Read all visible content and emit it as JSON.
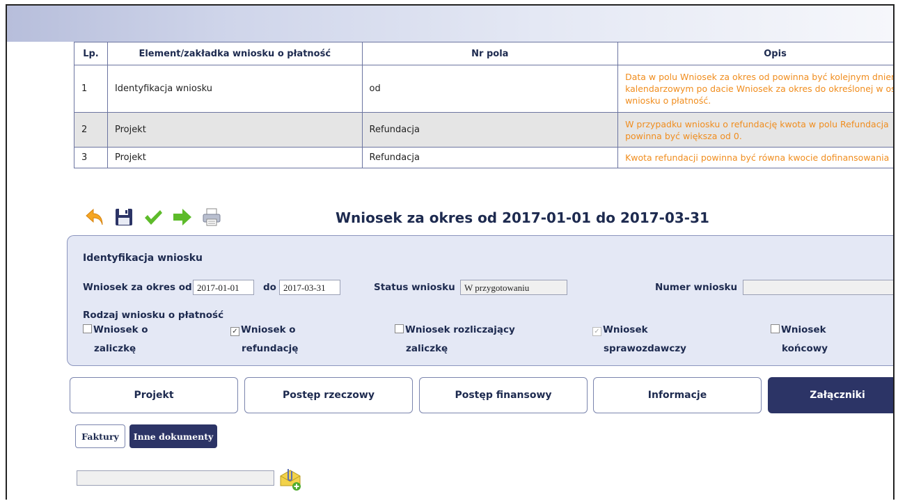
{
  "table": {
    "headers": [
      "Lp.",
      "Element/zakładka wniosku o płatność",
      "Nr pola",
      "Opis"
    ],
    "rows": [
      {
        "lp": "1",
        "element": "Identyfikacja wniosku",
        "pole": "od",
        "opis": "Data w polu Wniosek za okres od powinna być kolejnym dniem kalendarzowym po dacie Wniosek za okres do określonej w ostatnim wniosku o płatność."
      },
      {
        "lp": "2",
        "element": "Projekt",
        "pole": "Refundacja",
        "opis": "W przypadku wniosku o refundację kwota w polu Refundacja powinna być większa od 0."
      },
      {
        "lp": "3",
        "element": "Projekt",
        "pole": "Refundacja",
        "opis": "Kwota refundacji powinna być równa kwocie dofinansowania"
      }
    ]
  },
  "toolbar": {
    "icons": [
      "back-arrow-icon",
      "save-icon",
      "check-icon",
      "forward-arrow-icon",
      "print-icon"
    ]
  },
  "title": "Wniosek za okres od 2017-01-01 do 2017-03-31",
  "form": {
    "section": "Identyfikacja wniosku",
    "okres_od_label": "Wniosek za okres od",
    "okres_od": "2017-01-01",
    "do_label": "do",
    "okres_do": "2017-03-31",
    "status_label": "Status wniosku",
    "status": "W przygotowaniu",
    "numer_label": "Numer wniosku",
    "numer": "",
    "rodzaj_label": "Rodzaj wniosku o płatność",
    "checkboxes": [
      {
        "line1": "Wniosek o",
        "line2": "zaliczkę",
        "checked": false,
        "mark": ""
      },
      {
        "line1": "Wniosek o",
        "line2": "refundację",
        "checked": true,
        "mark": "✓"
      },
      {
        "line1": "Wniosek rozliczający",
        "line2": "zaliczkę",
        "checked": false,
        "mark": ""
      },
      {
        "line1": "Wniosek",
        "line2": "sprawozdawczy",
        "checked": true,
        "mark": "✓"
      },
      {
        "line1": "Wniosek",
        "line2": "końcowy",
        "checked": false,
        "mark": ""
      }
    ]
  },
  "tabs": [
    "Projekt",
    "Postęp rzeczowy",
    "Postęp finansowy",
    "Informacje",
    "Załączniki"
  ],
  "subtabs": [
    "Faktury",
    "Inne dokumenty"
  ],
  "colors": {
    "accent": "#2c3466",
    "warning": "#f08d1e",
    "panel": "#e4e8f5"
  }
}
